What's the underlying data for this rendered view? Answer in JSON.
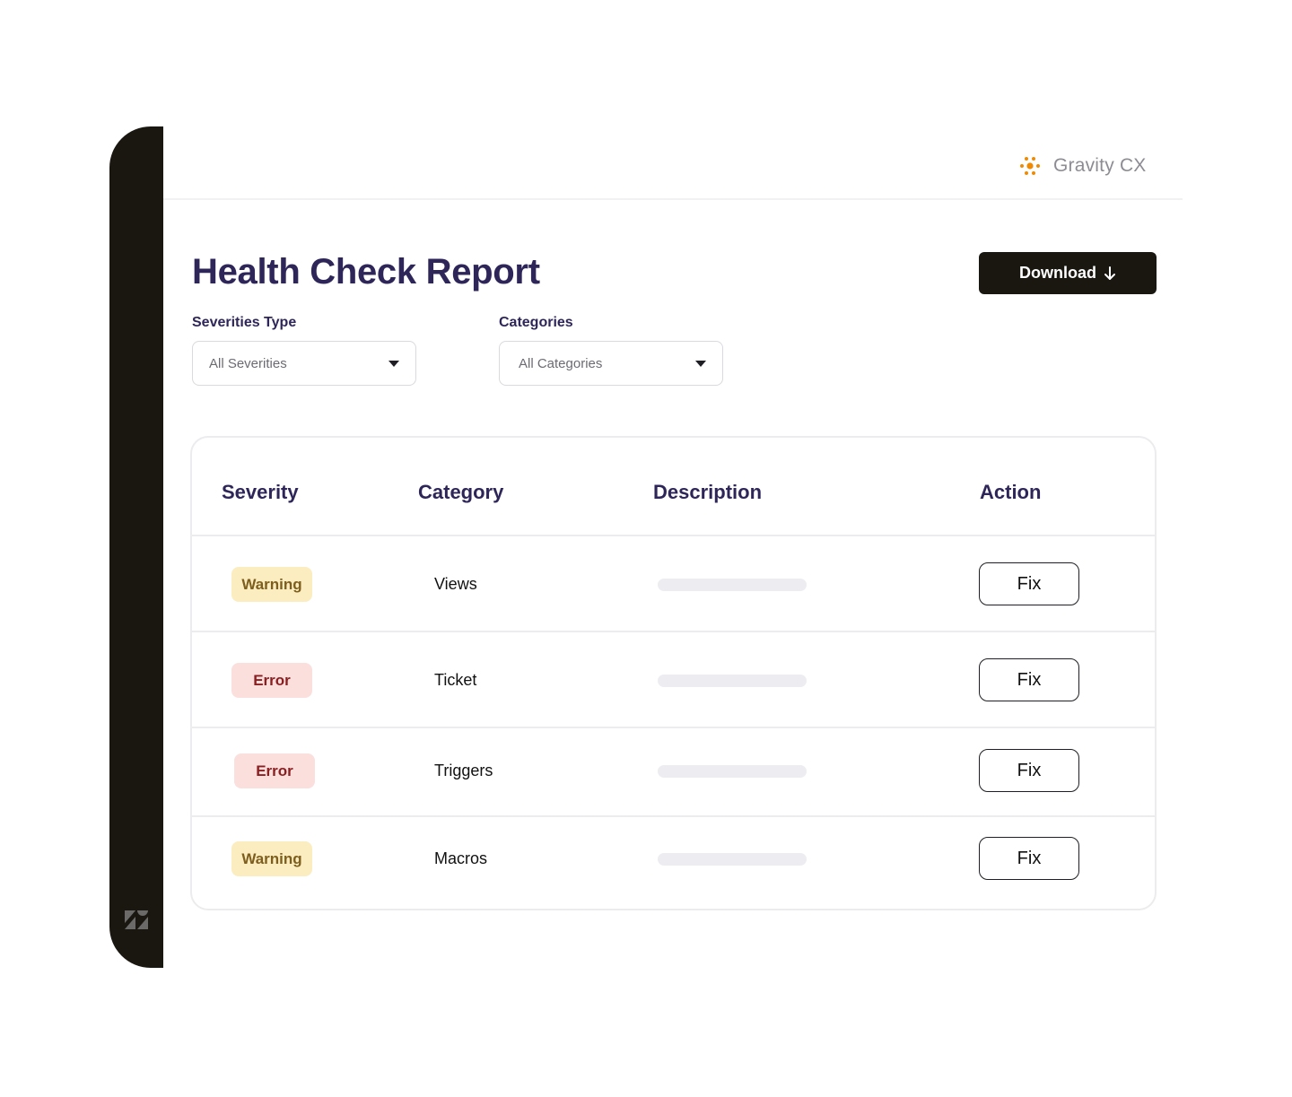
{
  "brand": {
    "name": "Gravity CX",
    "icon": "gravity-dots-icon",
    "color": "#f08a00"
  },
  "sidebar": {
    "logo_icon": "zendesk-logo-icon"
  },
  "page": {
    "title": "Health Check Report",
    "download_label": "Download",
    "download_icon": "arrow-down-icon"
  },
  "filters": {
    "severity": {
      "label": "Severities Type",
      "value": "All Severities"
    },
    "category": {
      "label": "Categories",
      "value": "All Categories"
    }
  },
  "table": {
    "headers": [
      "Severity",
      "Category",
      "Description",
      "Action"
    ],
    "rows": [
      {
        "severity": "Warning",
        "severity_type": "warning",
        "category": "Views",
        "description": "",
        "action": "Fix"
      },
      {
        "severity": "Error",
        "severity_type": "error",
        "category": "Ticket",
        "description": "",
        "action": "Fix"
      },
      {
        "severity": "Error",
        "severity_type": "error",
        "category": "Triggers",
        "description": "",
        "action": "Fix"
      },
      {
        "severity": "Warning",
        "severity_type": "warning",
        "category": "Macros",
        "description": "",
        "action": "Fix"
      }
    ]
  },
  "colors": {
    "title": "#2e2658",
    "dark": "#1a1610",
    "warning_bg": "#fbedbf",
    "warning_text": "#7d5e1e",
    "error_bg": "#fbdfdd",
    "error_text": "#8a1f22"
  }
}
